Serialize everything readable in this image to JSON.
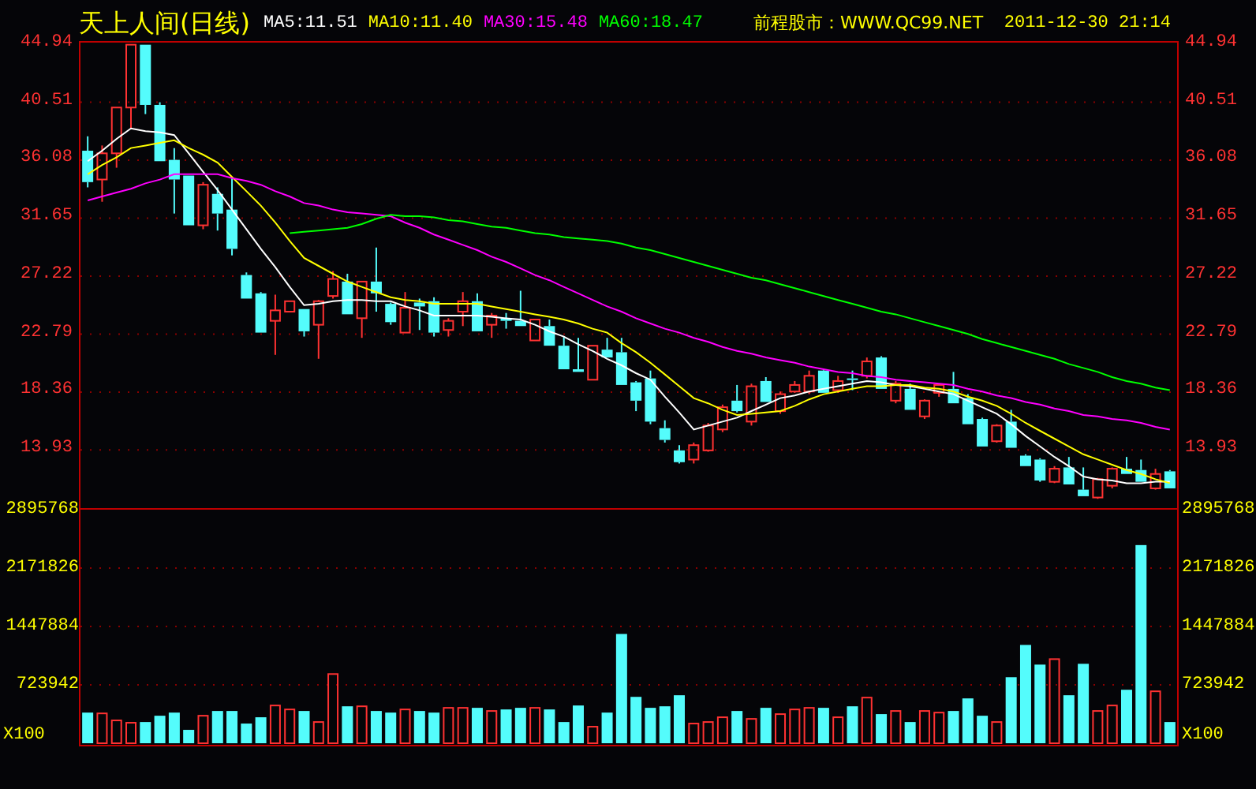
{
  "header": {
    "title": "天上人间(日线)",
    "indicators": [
      {
        "text": "MA5:11.51",
        "color": "#ffffff"
      },
      {
        "text": "MA10:11.40",
        "color": "#ffff00"
      },
      {
        "text": "MA30:15.48",
        "color": "#ff00ff"
      },
      {
        "text": "MA60:18.47",
        "color": "#00ff00"
      }
    ],
    "source": "前程股市：WWW.QC99.NET",
    "datetime": "2011-12-30 21:14"
  },
  "price_panel": {
    "right_axis": [
      "44.94",
      "40.51",
      "36.08",
      "31.65",
      "27.22",
      "22.79",
      "18.36",
      "13.93"
    ],
    "chart_data": {
      "type": "candlestick",
      "grid": true,
      "ylim": [
        9.49,
        44.94
      ],
      "yticks": [
        {
          "value": 44.94,
          "label": "44.94"
        },
        {
          "value": 40.51,
          "label": "40.51"
        },
        {
          "value": 36.08,
          "label": "36.08"
        },
        {
          "value": 31.65,
          "label": "31.65"
        },
        {
          "value": 27.22,
          "label": "27.22"
        },
        {
          "value": 22.79,
          "label": "22.79"
        },
        {
          "value": 18.36,
          "label": "18.36"
        },
        {
          "value": 13.93,
          "label": "13.93"
        }
      ],
      "categories": [
        null,
        null,
        null,
        null,
        null,
        null,
        null,
        null,
        null,
        null,
        null,
        null,
        null,
        null,
        null,
        null,
        null,
        null,
        null,
        null,
        null,
        null,
        null,
        null,
        null,
        null,
        null,
        null,
        null,
        null,
        null,
        null,
        null,
        null,
        null,
        null,
        null,
        null,
        null,
        null,
        null,
        null,
        null,
        null,
        null,
        null,
        null,
        null,
        null,
        null,
        null,
        null,
        null,
        null,
        null,
        null,
        null,
        null,
        null,
        null,
        null,
        null,
        null,
        null,
        null,
        null,
        null,
        null,
        null,
        null,
        null,
        null,
        null,
        null,
        null,
        null
      ],
      "ohlc": [
        [
          36.8,
          37.9,
          34.0,
          34.4
        ],
        [
          34.6,
          37.2,
          32.9,
          36.6
        ],
        [
          36.6,
          40.1,
          35.5,
          40.1
        ],
        [
          40.1,
          44.9,
          38.5,
          44.9
        ],
        [
          44.9,
          44.9,
          39.6,
          40.3
        ],
        [
          40.3,
          40.5,
          36.0,
          36.0
        ],
        [
          36.1,
          37.0,
          32.0,
          34.6
        ],
        [
          34.9,
          34.9,
          31.1,
          31.1
        ],
        [
          31.1,
          34.4,
          30.8,
          34.2
        ],
        [
          33.5,
          34.0,
          30.7,
          32.0
        ],
        [
          32.3,
          34.8,
          28.8,
          29.3
        ],
        [
          27.3,
          27.5,
          25.5,
          25.5
        ],
        [
          25.9,
          26.0,
          22.9,
          22.9
        ],
        [
          23.8,
          25.8,
          21.2,
          24.6
        ],
        [
          24.5,
          25.3,
          24.5,
          25.3
        ],
        [
          24.7,
          24.7,
          22.6,
          23.0
        ],
        [
          23.5,
          25.4,
          20.9,
          25.3
        ],
        [
          25.7,
          27.6,
          25.5,
          27.0
        ],
        [
          26.8,
          27.4,
          24.3,
          24.3
        ],
        [
          24.0,
          26.8,
          22.5,
          26.8
        ],
        [
          26.8,
          29.4,
          24.5,
          25.9
        ],
        [
          25.1,
          25.2,
          23.5,
          23.7
        ],
        [
          22.9,
          26.0,
          22.9,
          24.8
        ],
        [
          25.2,
          25.5,
          23.1,
          24.9
        ],
        [
          25.3,
          25.6,
          22.6,
          22.9
        ],
        [
          23.1,
          24.0,
          22.6,
          23.8
        ],
        [
          24.5,
          26.0,
          23.4,
          25.3
        ],
        [
          25.3,
          25.9,
          23.0,
          23.0
        ],
        [
          23.5,
          24.4,
          22.5,
          24.2
        ],
        [
          24.0,
          24.4,
          23.2,
          23.8
        ],
        [
          23.8,
          26.1,
          23.4,
          23.4
        ],
        [
          22.3,
          23.9,
          22.3,
          23.9
        ],
        [
          23.4,
          23.9,
          21.9,
          21.9
        ],
        [
          21.9,
          22.6,
          20.1,
          20.1
        ],
        [
          20.1,
          22.5,
          19.9,
          19.9
        ],
        [
          19.3,
          21.9,
          19.3,
          21.9
        ],
        [
          21.6,
          22.5,
          21.0,
          21.0
        ],
        [
          21.4,
          22.5,
          18.9,
          18.9
        ],
        [
          19.1,
          19.2,
          16.9,
          17.7
        ],
        [
          19.4,
          20.0,
          15.9,
          16.1
        ],
        [
          15.6,
          16.2,
          14.5,
          14.7
        ],
        [
          13.9,
          14.3,
          12.9,
          13.0
        ],
        [
          13.2,
          14.5,
          12.9,
          14.3
        ],
        [
          13.9,
          16.0,
          13.8,
          15.8
        ],
        [
          15.5,
          17.4,
          15.3,
          17.2
        ],
        [
          17.7,
          18.9,
          16.8,
          16.9
        ],
        [
          16.1,
          19.0,
          15.8,
          18.8
        ],
        [
          19.2,
          19.5,
          17.6,
          17.6
        ],
        [
          16.9,
          18.4,
          16.7,
          18.2
        ],
        [
          18.4,
          19.2,
          18.3,
          18.9
        ],
        [
          18.4,
          20.0,
          18.2,
          19.6
        ],
        [
          20.0,
          20.1,
          18.3,
          18.3
        ],
        [
          18.5,
          19.6,
          18.3,
          19.2
        ],
        [
          19.4,
          20.0,
          18.5,
          19.3
        ],
        [
          19.6,
          21.0,
          19.4,
          20.7
        ],
        [
          21.0,
          21.1,
          18.6,
          18.6
        ],
        [
          17.7,
          19.2,
          17.5,
          19.0
        ],
        [
          18.6,
          19.0,
          17.0,
          17.0
        ],
        [
          16.5,
          17.8,
          16.3,
          17.7
        ],
        [
          18.3,
          19.0,
          18.0,
          18.9
        ],
        [
          18.6,
          19.9,
          17.5,
          17.5
        ],
        [
          17.9,
          18.2,
          15.9,
          15.9
        ],
        [
          16.3,
          16.4,
          14.2,
          14.2
        ],
        [
          14.6,
          15.9,
          14.5,
          15.8
        ],
        [
          16.1,
          17.0,
          14.1,
          14.1
        ],
        [
          13.5,
          13.6,
          12.7,
          12.7
        ],
        [
          13.2,
          13.3,
          11.5,
          11.6
        ],
        [
          11.5,
          12.7,
          11.4,
          12.5
        ],
        [
          12.6,
          13.4,
          11.3,
          11.3
        ],
        [
          10.9,
          12.6,
          10.4,
          10.4
        ],
        [
          10.3,
          11.8,
          10.2,
          11.7
        ],
        [
          11.2,
          12.6,
          11.0,
          12.5
        ],
        [
          12.5,
          13.4,
          12.1,
          12.1
        ],
        [
          12.4,
          13.2,
          11.5,
          11.5
        ],
        [
          11.0,
          12.5,
          10.9,
          12.1
        ],
        [
          12.3,
          12.4,
          11.0,
          11.0
        ]
      ],
      "series": [
        {
          "type": "line",
          "color": "#ffffff",
          "values": [
            36.0,
            36.8,
            37.7,
            38.5,
            38.3,
            38.2,
            38.0,
            36.6,
            35.2,
            33.8,
            32.3,
            30.8,
            29.3,
            27.9,
            26.4,
            25.0,
            25.1,
            25.3,
            25.4,
            25.4,
            25.3,
            25.3,
            24.9,
            24.6,
            24.2,
            24.2,
            24.2,
            24.2,
            24.1,
            24.0,
            23.9,
            23.5,
            23.0,
            22.6,
            22.0,
            21.5,
            20.9,
            20.4,
            19.8,
            19.3,
            18.0,
            16.8,
            15.5,
            15.8,
            16.1,
            16.4,
            16.9,
            17.4,
            17.9,
            18.1,
            18.4,
            18.6,
            18.8,
            19.0,
            19.2,
            19.1,
            18.9,
            18.8,
            18.6,
            18.4,
            18.2,
            17.7,
            17.2,
            16.7,
            15.9,
            15.0,
            14.2,
            13.4,
            12.7,
            11.9,
            11.7,
            11.6,
            11.4,
            11.4,
            11.5,
            11.5
          ]
        },
        {
          "type": "line",
          "color": "#ffff00",
          "values": [
            35.0,
            35.7,
            36.3,
            37.0,
            37.2,
            37.4,
            37.6,
            37.0,
            36.5,
            35.9,
            34.8,
            33.7,
            32.6,
            31.3,
            29.9,
            28.6,
            28.0,
            27.4,
            26.8,
            26.4,
            26.0,
            25.6,
            25.4,
            25.3,
            25.1,
            25.1,
            25.1,
            25.1,
            24.9,
            24.7,
            24.5,
            24.3,
            24.1,
            23.9,
            23.6,
            23.2,
            22.9,
            22.1,
            21.4,
            20.6,
            19.7,
            18.8,
            17.9,
            17.5,
            17.0,
            16.6,
            16.7,
            16.8,
            16.9,
            17.3,
            17.8,
            18.2,
            18.4,
            18.6,
            18.8,
            18.8,
            18.9,
            18.9,
            18.7,
            18.6,
            18.4,
            18.0,
            17.7,
            17.3,
            16.7,
            16.0,
            15.4,
            14.8,
            14.2,
            13.6,
            13.2,
            12.8,
            12.4,
            12.1,
            11.7,
            11.4
          ]
        },
        {
          "type": "line",
          "color": "#ff00ff",
          "values": [
            33.0,
            33.3,
            33.6,
            33.9,
            34.3,
            34.6,
            35.0,
            35.0,
            35.0,
            35.0,
            34.7,
            34.5,
            34.2,
            33.7,
            33.3,
            32.8,
            32.6,
            32.3,
            32.1,
            32.0,
            31.9,
            31.8,
            31.3,
            30.9,
            30.4,
            30.0,
            29.6,
            29.2,
            28.7,
            28.3,
            27.8,
            27.3,
            26.9,
            26.4,
            25.9,
            25.4,
            24.9,
            24.5,
            24.0,
            23.6,
            23.2,
            22.9,
            22.5,
            22.2,
            21.8,
            21.5,
            21.3,
            21.0,
            20.8,
            20.6,
            20.3,
            20.1,
            19.9,
            19.8,
            19.6,
            19.5,
            19.3,
            19.2,
            19.1,
            19.0,
            18.9,
            18.6,
            18.4,
            18.1,
            17.9,
            17.6,
            17.4,
            17.1,
            16.9,
            16.6,
            16.5,
            16.3,
            16.2,
            16.0,
            15.7,
            15.5
          ]
        },
        {
          "type": "line",
          "color": "#00ff00",
          "values": [
            null,
            null,
            null,
            null,
            null,
            null,
            null,
            null,
            null,
            null,
            null,
            null,
            null,
            null,
            30.5,
            30.6,
            30.7,
            30.8,
            30.9,
            31.2,
            31.6,
            31.9,
            31.8,
            31.8,
            31.7,
            31.5,
            31.4,
            31.2,
            31.0,
            30.9,
            30.7,
            30.5,
            30.4,
            30.2,
            30.1,
            30.0,
            29.9,
            29.7,
            29.4,
            29.2,
            28.9,
            28.6,
            28.3,
            28.0,
            27.7,
            27.4,
            27.1,
            26.9,
            26.6,
            26.3,
            26.0,
            25.7,
            25.4,
            25.1,
            24.8,
            24.5,
            24.3,
            24.0,
            23.7,
            23.4,
            23.1,
            22.8,
            22.4,
            22.1,
            21.8,
            21.5,
            21.2,
            20.9,
            20.5,
            20.2,
            19.9,
            19.5,
            19.2,
            19.0,
            18.7,
            18.5
          ]
        }
      ]
    }
  },
  "volume_panel": {
    "right_axis": [
      "2895768",
      "2171826",
      "1447884",
      "723942"
    ],
    "left_unit": "X100",
    "right_unit": "X100",
    "chart_data": {
      "type": "bar",
      "grid": true,
      "ylim": [
        0,
        2895768
      ],
      "categories": [
        null,
        null,
        null,
        null,
        null,
        null,
        null,
        null,
        null,
        null,
        null,
        null,
        null,
        null,
        null,
        null,
        null,
        null,
        null,
        null,
        null,
        null,
        null,
        null,
        null,
        null,
        null,
        null,
        null,
        null,
        null,
        null,
        null,
        null,
        null,
        null,
        null,
        null,
        null,
        null,
        null,
        null,
        null,
        null,
        null,
        null,
        null,
        null,
        null,
        null,
        null,
        null,
        null,
        null,
        null,
        null,
        null,
        null,
        null,
        null,
        null,
        null,
        null,
        null,
        null,
        null,
        null,
        null,
        null,
        null,
        null,
        null,
        null,
        null,
        null,
        null
      ],
      "yticks": [
        {
          "value": 2895768,
          "label": "2895768"
        },
        {
          "value": 2171826,
          "label": "2171826"
        },
        {
          "value": 1447884,
          "label": "1447884"
        },
        {
          "value": 723942,
          "label": "723942"
        }
      ],
      "series": [
        {
          "color": "#ff3232",
          "values": [
            null,
            370000,
            283000,
            254000,
            null,
            null,
            null,
            null,
            341000,
            null,
            null,
            null,
            null,
            468000,
            419000,
            null,
            263000,
            858000,
            null,
            458000,
            null,
            null,
            419000,
            null,
            null,
            439000,
            439000,
            null,
            400000,
            null,
            null,
            439000,
            null,
            null,
            null,
            205000,
            null,
            null,
            null,
            null,
            null,
            null,
            244000,
            263000,
            322000,
            null,
            302000,
            null,
            361000,
            419000,
            439000,
            null,
            322000,
            null,
            566000,
            null,
            400000,
            null,
            400000,
            380000,
            null,
            null,
            null,
            263000,
            null,
            null,
            null,
            1043000,
            null,
            null,
            400000,
            468000,
            null,
            null,
            644000,
            null
          ]
        },
        {
          "color": "#54fcfc",
          "values": [
            380000,
            null,
            null,
            null,
            263000,
            341000,
            380000,
            166000,
            null,
            400000,
            400000,
            244000,
            322000,
            null,
            null,
            400000,
            null,
            null,
            458000,
            null,
            400000,
            380000,
            null,
            400000,
            380000,
            null,
            null,
            439000,
            null,
            419000,
            439000,
            null,
            419000,
            263000,
            468000,
            null,
            380000,
            1355000,
            575000,
            439000,
            458000,
            595000,
            null,
            null,
            null,
            400000,
            null,
            439000,
            null,
            null,
            null,
            439000,
            null,
            458000,
            null,
            361000,
            null,
            263000,
            null,
            null,
            400000,
            556000,
            341000,
            null,
            819000,
            1219000,
            975000,
            null,
            595000,
            985000,
            null,
            null,
            663000,
            2457000,
            null,
            263000
          ]
        }
      ]
    }
  }
}
